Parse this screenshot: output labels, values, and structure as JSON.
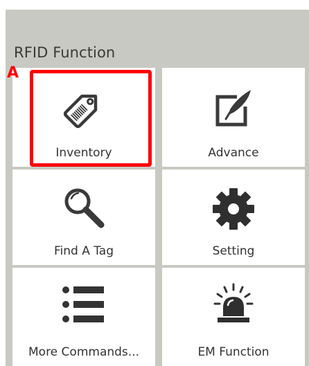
{
  "section_title": "RFID Function",
  "marker_label": "A",
  "highlight_color": "#ff0000",
  "tiles": [
    {
      "label": "Inventory",
      "icon": "tag-icon"
    },
    {
      "label": "Advance",
      "icon": "edit-pen-icon"
    },
    {
      "label": "Find A Tag",
      "icon": "search-icon"
    },
    {
      "label": "Setting",
      "icon": "gear-icon"
    },
    {
      "label": "More Commands...",
      "icon": "list-icon"
    },
    {
      "label": "EM Function",
      "icon": "alarm-light-icon"
    }
  ]
}
